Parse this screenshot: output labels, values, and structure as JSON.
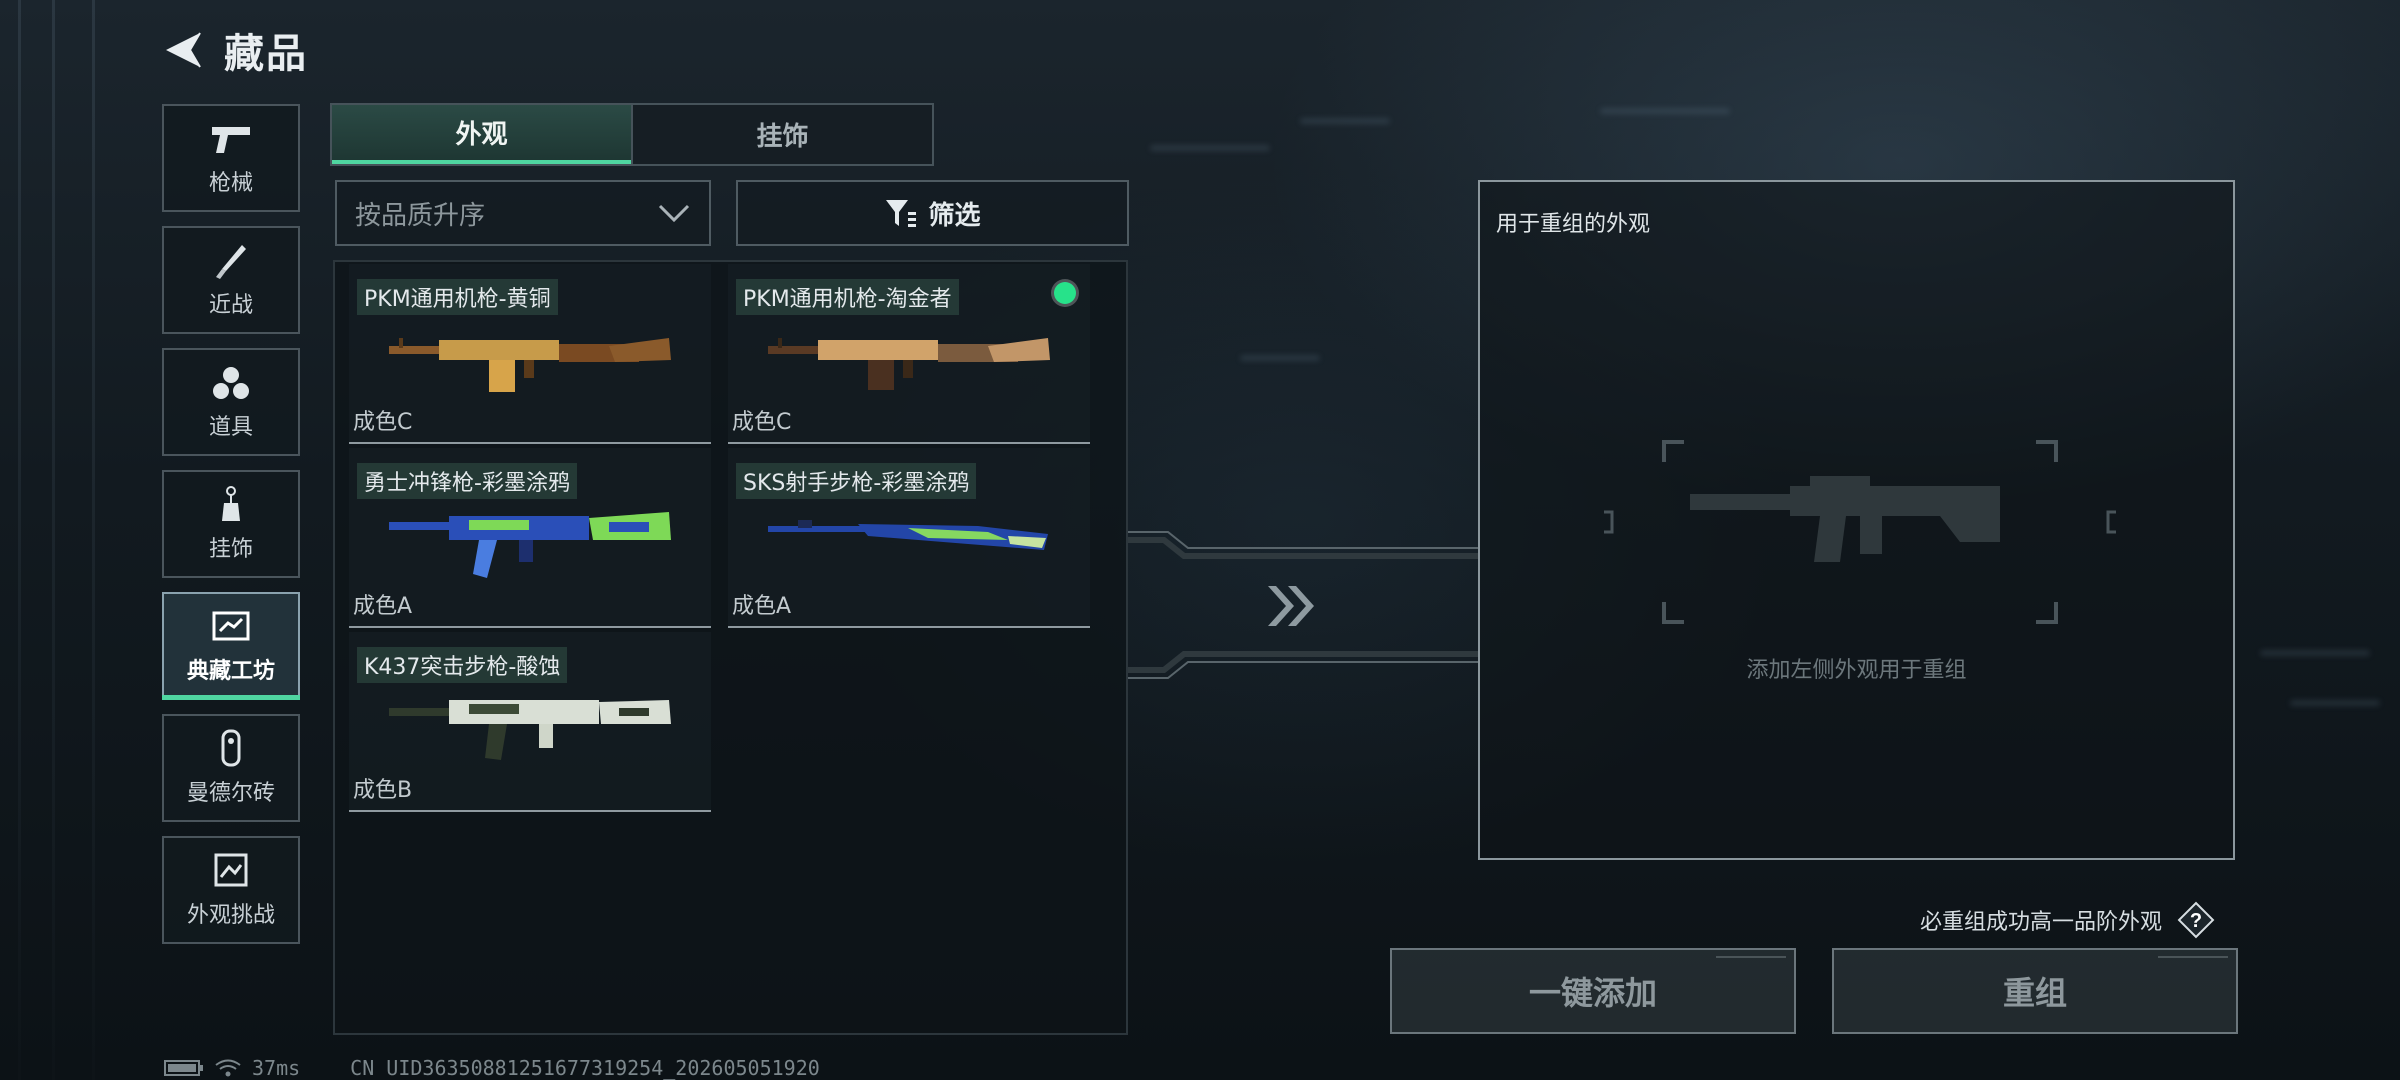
{
  "header": {
    "title": "藏品"
  },
  "nav": {
    "items": [
      {
        "label": "枪械",
        "icon": "pistol-icon",
        "active": false
      },
      {
        "label": "近战",
        "icon": "knife-icon",
        "active": false
      },
      {
        "label": "道具",
        "icon": "grenades-icon",
        "active": false
      },
      {
        "label": "挂饰",
        "icon": "charm-icon",
        "active": false
      },
      {
        "label": "典藏工坊",
        "icon": "workshop-icon",
        "active": true
      },
      {
        "label": "曼德尔砖",
        "icon": "brick-icon",
        "active": false
      },
      {
        "label": "外观挑战",
        "icon": "challenge-icon",
        "active": false
      }
    ]
  },
  "tabs": [
    {
      "label": "外观",
      "active": true
    },
    {
      "label": "挂饰",
      "active": false
    }
  ],
  "sort": {
    "label": "按品质升序"
  },
  "filter": {
    "label": "筛选"
  },
  "items": [
    {
      "name": "PKM通用机枪-黄铜",
      "grade": "成色C",
      "equipped": false,
      "colors": [
        "#8a5a2b",
        "#c79b4a"
      ]
    },
    {
      "name": "PKM通用机枪-淘金者",
      "grade": "成色C",
      "equipped": true,
      "colors": [
        "#5a3a24",
        "#d1a36a"
      ]
    },
    {
      "name": "勇士冲锋枪-彩墨涂鸦",
      "grade": "成色A",
      "equipped": false,
      "colors": [
        "#2a4fb8",
        "#7ed957"
      ]
    },
    {
      "name": "SKS射手步枪-彩墨涂鸦",
      "grade": "成色A",
      "equipped": false,
      "colors": [
        "#2346a8",
        "#86d860"
      ]
    },
    {
      "name": "K437突击步枪-酸蚀",
      "grade": "成色B",
      "equipped": false,
      "colors": [
        "#d9dfd5",
        "#2f3a2c"
      ]
    }
  ],
  "recombine": {
    "title": "用于重组的外观",
    "hint": "添加左侧外观用于重组"
  },
  "guarantee": {
    "text": "必重组成功高一品阶外观"
  },
  "buttons": {
    "add_all": "一键添加",
    "recombine": "重组"
  },
  "status": {
    "ping": "37ms",
    "uid": "CN UID3635088125167731925​4_202605051920"
  },
  "colors": {
    "accent": "#4fd6a1",
    "equipped": "#27e28a"
  }
}
